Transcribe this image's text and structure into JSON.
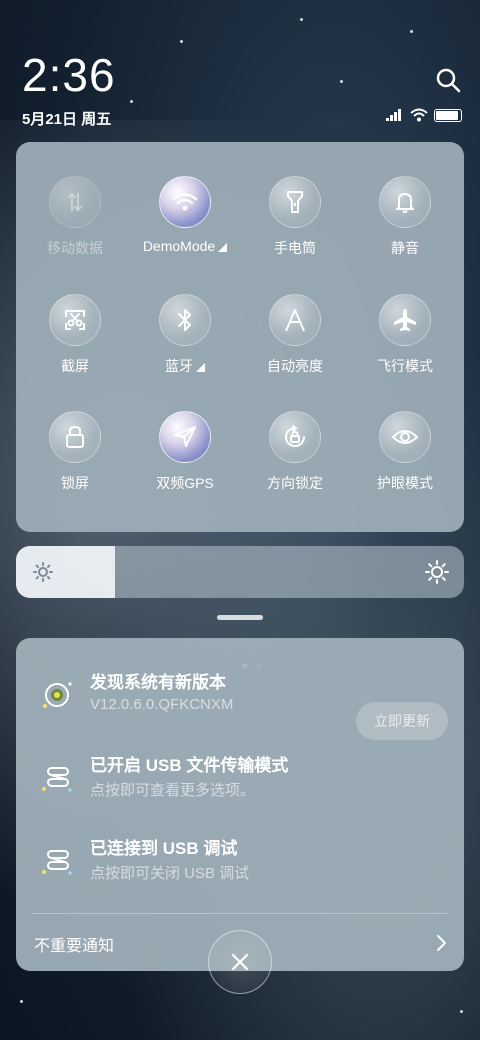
{
  "status_bar": {
    "time": "2:36",
    "date": "5月21日 周五",
    "battery_level": 0.9
  },
  "quick_settings": {
    "tiles": [
      {
        "label": "移动数据",
        "icon": "mobile-data-icon",
        "state": "disabled"
      },
      {
        "label": "DemoMode",
        "icon": "wifi-icon",
        "state": "on",
        "expandable": true
      },
      {
        "label": "手电筒",
        "icon": "flashlight-icon",
        "state": "off"
      },
      {
        "label": "静音",
        "icon": "bell-icon",
        "state": "off"
      },
      {
        "label": "截屏",
        "icon": "screenshot-icon",
        "state": "off"
      },
      {
        "label": "蓝牙",
        "icon": "bluetooth-icon",
        "state": "off",
        "expandable": true
      },
      {
        "label": "自动亮度",
        "icon": "auto-brightness-icon",
        "state": "off"
      },
      {
        "label": "飞行模式",
        "icon": "airplane-icon",
        "state": "off"
      },
      {
        "label": "锁屏",
        "icon": "lock-icon",
        "state": "off"
      },
      {
        "label": "双频GPS",
        "icon": "gps-icon",
        "state": "on"
      },
      {
        "label": "方向锁定",
        "icon": "rotation-lock-icon",
        "state": "off"
      },
      {
        "label": "护眼模式",
        "icon": "eye-icon",
        "state": "off"
      }
    ],
    "pages": 2,
    "current_page": 1
  },
  "brightness": {
    "level": 0.22
  },
  "notifications": [
    {
      "title": "发现系统有新版本",
      "subtitle": "V12.0.6.0.QFKCNXM",
      "action": "立即更新"
    },
    {
      "title": "已开启 USB 文件传输模式",
      "subtitle": "点按即可查看更多选项。"
    },
    {
      "title": "已连接到 USB 调试",
      "subtitle": "点按即可关闭 USB 调试"
    }
  ],
  "unimportant_label": "不重要通知",
  "colors": {
    "panel": "#a0b0ba",
    "accent_on": "#8a92c9"
  }
}
